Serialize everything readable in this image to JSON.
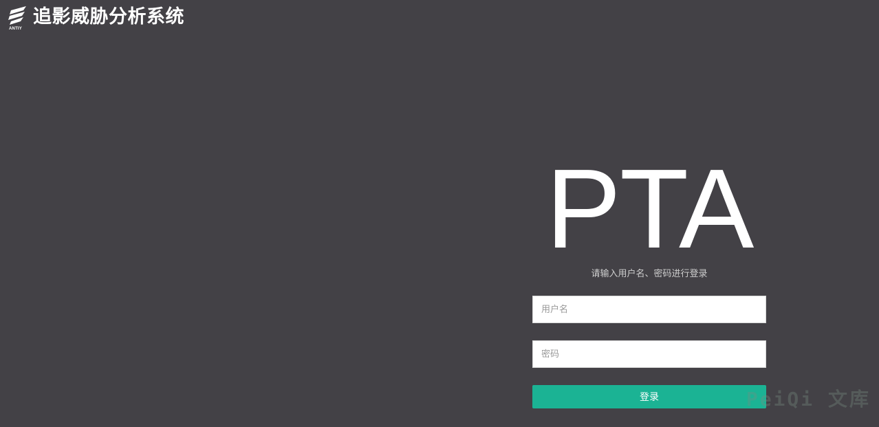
{
  "header": {
    "logo_icon": "antiy-logo-icon",
    "logo_text": "ANTIY",
    "title": "追影威胁分析系统"
  },
  "login": {
    "brand": "PTA",
    "subtitle": "请输入用户名、密码进行登录",
    "username_placeholder": "用户名",
    "password_placeholder": "密码",
    "submit_label": "登录"
  },
  "watermark": "PeiQi 文库",
  "colors": {
    "background": "#434146",
    "accent": "#1bb394",
    "text": "#ffffff"
  }
}
